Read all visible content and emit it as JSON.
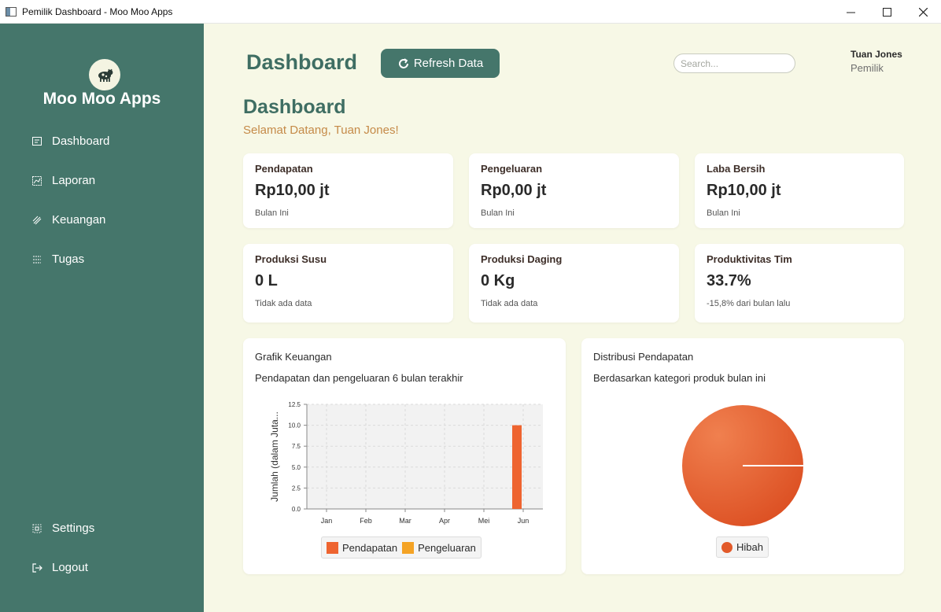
{
  "window": {
    "title": "Pemilik Dashboard - Moo Moo Apps"
  },
  "sidebar": {
    "brand": "Moo Moo Apps",
    "items": [
      {
        "label": "Dashboard",
        "icon": "dashboard-icon"
      },
      {
        "label": "Laporan",
        "icon": "report-icon"
      },
      {
        "label": "Keuangan",
        "icon": "finance-icon"
      },
      {
        "label": "Tugas",
        "icon": "tasks-icon"
      }
    ],
    "bottom": [
      {
        "label": "Settings",
        "icon": "settings-icon"
      },
      {
        "label": "Logout",
        "icon": "logout-icon"
      }
    ]
  },
  "header": {
    "title": "Dashboard",
    "refresh_label": "Refresh Data",
    "search_placeholder": "Search...",
    "user_name": "Tuan Jones",
    "user_role": "Pemilik"
  },
  "main": {
    "title": "Dashboard",
    "welcome": "Selamat Datang, Tuan Jones!"
  },
  "stats": [
    {
      "label": "Pendapatan",
      "value": "Rp10,00 jt",
      "sub": "Bulan Ini"
    },
    {
      "label": "Pengeluaran",
      "value": "Rp0,00 jt",
      "sub": "Bulan Ini"
    },
    {
      "label": "Laba Bersih",
      "value": "Rp10,00 jt",
      "sub": "Bulan Ini"
    },
    {
      "label": "Produksi Susu",
      "value": "0 L",
      "sub": "Tidak ada data"
    },
    {
      "label": "Produksi Daging",
      "value": "0 Kg",
      "sub": "Tidak ada data"
    },
    {
      "label": "Produktivitas Tim",
      "value": "33.7%",
      "sub": "-15,8% dari bulan lalu"
    }
  ],
  "finance_chart": {
    "title": "Grafik Keuangan",
    "subtitle": "Pendapatan dan pengeluaran 6 bulan terakhir"
  },
  "income_chart": {
    "title": "Distribusi Pendapatan",
    "subtitle": "Berdasarkan kategori produk bulan ini"
  },
  "chart_data": [
    {
      "type": "bar",
      "categories": [
        "Jan",
        "Feb",
        "Mar",
        "Apr",
        "Mei",
        "Jun"
      ],
      "series": [
        {
          "name": "Pendapatan",
          "values": [
            0,
            0,
            0,
            0,
            0,
            10
          ],
          "color": "#ee6430"
        },
        {
          "name": "Pengeluaran",
          "values": [
            0,
            0,
            0,
            0,
            0,
            0
          ],
          "color": "#f4a325"
        }
      ],
      "ylabel": "Jumlah (dalam Juta...",
      "ylim": [
        0,
        12.5
      ],
      "yticks": [
        "0.0",
        "2.5",
        "5.0",
        "7.5",
        "10.0",
        "12.5"
      ],
      "grid": true,
      "legend": "bottom"
    },
    {
      "type": "pie",
      "slices": [
        {
          "name": "Hibah",
          "value": 100,
          "color": "#e25a2a"
        }
      ],
      "legend": "bottom"
    }
  ]
}
